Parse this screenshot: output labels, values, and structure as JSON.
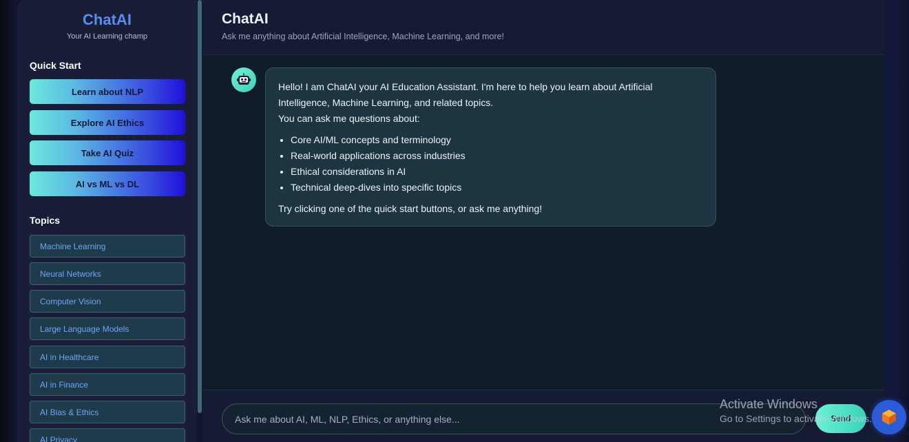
{
  "sidebar": {
    "brand_title": "ChatAI",
    "brand_subtitle": "Your AI Learning champ",
    "quick_start_heading": "Quick Start",
    "quick_start": [
      {
        "label": "Learn about NLP"
      },
      {
        "label": "Explore AI Ethics"
      },
      {
        "label": "Take AI Quiz"
      },
      {
        "label": "AI vs ML vs DL"
      }
    ],
    "topics_heading": "Topics",
    "topics": [
      {
        "label": "Machine Learning"
      },
      {
        "label": "Neural Networks"
      },
      {
        "label": "Computer Vision"
      },
      {
        "label": "Large Language Models"
      },
      {
        "label": "AI in Healthcare"
      },
      {
        "label": "AI in Finance"
      },
      {
        "label": "AI Bias & Ethics"
      },
      {
        "label": "AI Privacy"
      }
    ]
  },
  "header": {
    "title": "ChatAI",
    "subtitle": "Ask me anything about Artificial Intelligence, Machine Learning, and more!"
  },
  "message": {
    "intro": "Hello! I am ChatAI your AI Education Assistant. I'm here to help you learn about Artificial Intelligence, Machine Learning, and related topics.",
    "lead": "You can ask me questions about:",
    "items": [
      "Core AI/ML concepts and terminology",
      "Real-world applications across industries",
      "Ethical considerations in AI",
      "Technical deep-dives into specific topics"
    ],
    "closing": "Try clicking one of the quick start buttons, or ask me anything!"
  },
  "input": {
    "placeholder": "Ask me about AI, ML, NLP, Ethics, or anything else...",
    "value": "",
    "send_label": "Send"
  },
  "watermark": {
    "title": "Activate Windows",
    "subtitle": "Go to Settings to activate Windows."
  },
  "colors": {
    "brand": "#5b8cf0",
    "accent_teal": "#6ae8dc",
    "accent_blue": "#1f10d8",
    "topic_text": "#6ea7f5"
  },
  "icons": {
    "bot_avatar": "robot-icon",
    "fab": "cube-icon"
  }
}
